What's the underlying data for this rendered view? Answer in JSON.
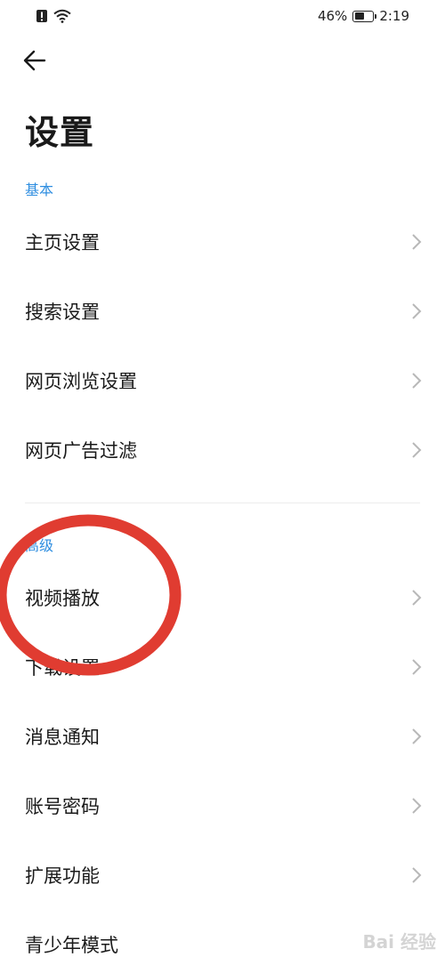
{
  "status_bar": {
    "battery_percent": "46%",
    "battery_level": 0.46,
    "time": "2:19",
    "icons": [
      "alert-icon",
      "wifi-icon",
      "battery-icon"
    ]
  },
  "header": {
    "back_icon": "arrow-left-icon",
    "title": "设置"
  },
  "sections": {
    "basic": {
      "label": "基本",
      "items": [
        {
          "label": "主页设置"
        },
        {
          "label": "搜索设置"
        },
        {
          "label": "网页浏览设置"
        },
        {
          "label": "网页广告过滤"
        }
      ]
    },
    "advanced": {
      "label": "高级",
      "items": [
        {
          "label": "视频播放"
        },
        {
          "label": "下载设置"
        },
        {
          "label": "消息通知"
        },
        {
          "label": "账号密码"
        },
        {
          "label": "扩展功能"
        },
        {
          "label": "青少年模式"
        }
      ]
    }
  },
  "colors": {
    "accent": "#2f8ee0",
    "annotation": "#e03c31",
    "chevron": "#b8b8b8"
  },
  "watermark": "Bai 经验"
}
